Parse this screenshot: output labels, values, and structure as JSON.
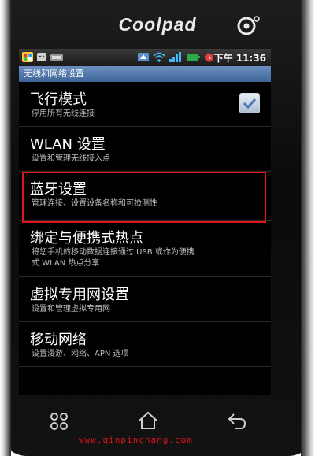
{
  "device": {
    "brand": "Coolpad"
  },
  "statusbar": {
    "time": "下午 11:36",
    "icons": [
      "app-icon",
      "android-icon",
      "battery-mini-icon",
      "usb-icon",
      "wifi-icon",
      "signal-icon",
      "battery-icon",
      "alarm-icon"
    ]
  },
  "screen": {
    "title": "无线和网络设置",
    "items": [
      {
        "title": "飞行模式",
        "subtitle": "停用所有无线连接",
        "checked": true
      },
      {
        "title": "WLAN 设置",
        "subtitle": "设置和管理无线接入点"
      },
      {
        "title": "蓝牙设置",
        "subtitle": "管理连接、设置设备名称和可检测性",
        "highlighted": true
      },
      {
        "title": "绑定与便携式热点",
        "subtitle_line1": "将您手机的移动数据连接通过 USB 或作为便携",
        "subtitle_line2": "式 WLAN 热点分享"
      },
      {
        "title": "虚拟专用网设置",
        "subtitle": "设置和管理虚拟专用网"
      },
      {
        "title": "移动网络",
        "subtitle": "设置漫游、网络、APN 选项"
      }
    ]
  },
  "navbar": {
    "buttons": [
      "menu-icon",
      "home-icon",
      "back-icon"
    ]
  },
  "watermark": "www.qinpinchang.com",
  "colors": {
    "accent_highlight": "#e0141c",
    "titlebar": "#4f76a8"
  }
}
